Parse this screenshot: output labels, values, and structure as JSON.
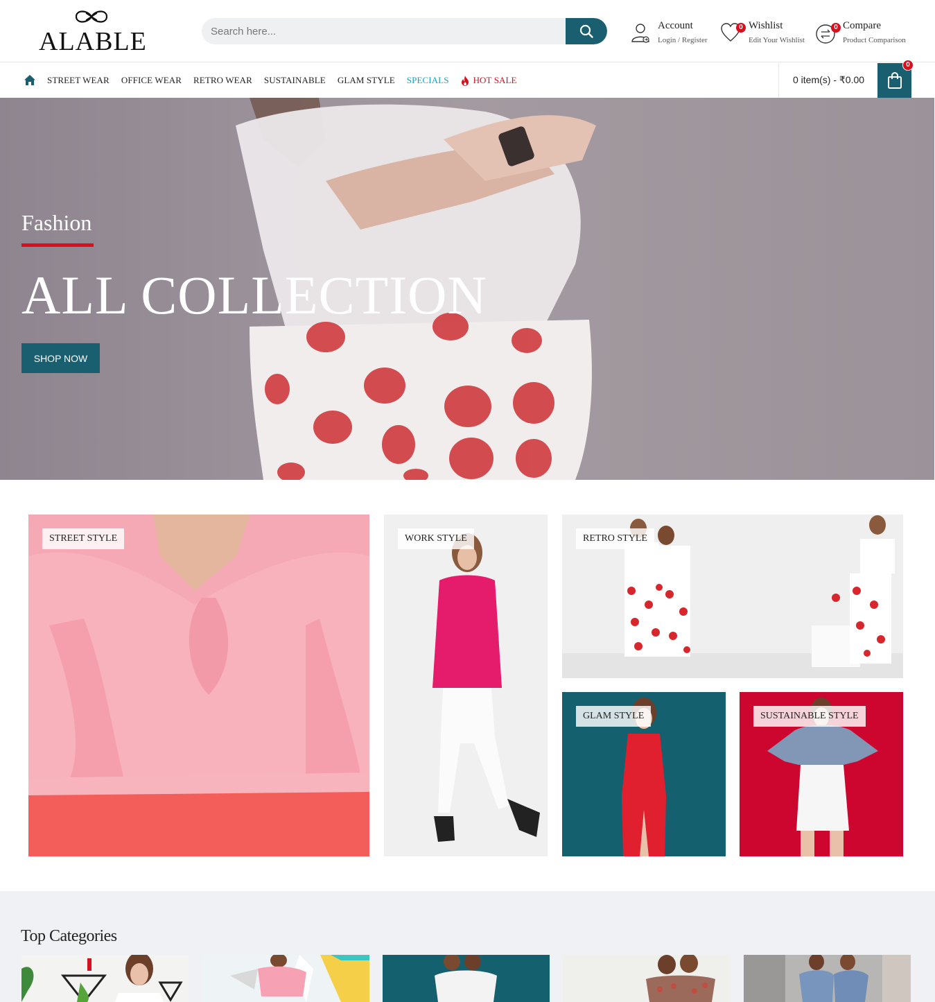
{
  "header": {
    "logo_text": "ALABLE",
    "search_placeholder": "Search here...",
    "account": {
      "title": "Account",
      "sub": "Login / Register"
    },
    "wishlist": {
      "title": "Wishlist",
      "sub": "Edit Your Wishlist",
      "count": "0"
    },
    "compare": {
      "title": "Compare",
      "sub": "Product Comparison",
      "count": "0"
    }
  },
  "nav": {
    "items": [
      "STREET WEAR",
      "OFFICE WEAR",
      "RETRO WEAR",
      "SUSTAINABLE",
      "GLAM STYLE",
      "SPECIALS",
      "HOT SALE"
    ],
    "cart_text": "0 item(s) - ₹0.00",
    "cart_count": "0"
  },
  "hero": {
    "subtitle": "Fashion",
    "title": "ALL COLLECTION",
    "button": "SHOP NOW"
  },
  "banners": [
    "STREET STYLE",
    "WORK STYLE",
    "RETRO STYLE",
    "GLAM STYLE",
    "SUSTAINABLE STYLE"
  ],
  "categories": {
    "heading": "Top Categories"
  },
  "colors": {
    "brand": "#1a5f70",
    "accent_red": "#d5101f",
    "special": "#16a3c0"
  },
  "icons": [
    "search-icon",
    "account-icon",
    "heart-icon",
    "compare-icon",
    "home-icon",
    "fire-icon",
    "shopping-bag-icon"
  ]
}
